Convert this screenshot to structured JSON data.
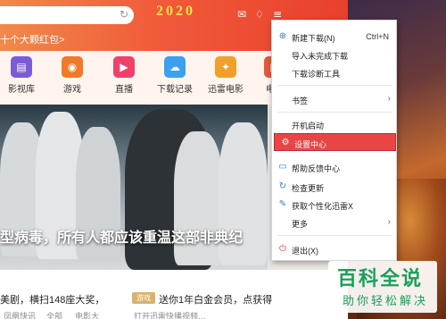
{
  "titlebar": {
    "promo_text": "十个大颗红包>",
    "logo_text": "2020",
    "icons": [
      "mail-icon",
      "shirt-icon",
      "menu-icon",
      "minimize-icon",
      "maximize-icon",
      "close-icon"
    ]
  },
  "nav": {
    "items": [
      {
        "label": "影视库",
        "icon": "film-library-icon",
        "color": "#7b5cd6"
      },
      {
        "label": "游戏",
        "icon": "gamepad-icon",
        "color": "#f07a2a"
      },
      {
        "label": "直播",
        "icon": "live-tv-icon",
        "color": "#f0416a"
      },
      {
        "label": "下载记录",
        "icon": "cloud-download-icon",
        "color": "#3aa0f0"
      },
      {
        "label": "迅雷电影",
        "icon": "thunder-movie-icon",
        "color": "#f0a02a"
      },
      {
        "label": "电影",
        "icon": "movie-icon",
        "color": "#e05a3a"
      }
    ]
  },
  "hero": {
    "caption": "型病毒，所有人都应该重温这部非典纪"
  },
  "bottom": {
    "line1_left": "美剧，横扫148座大奖，",
    "badge": "游戏",
    "line1_right": "送你1年白金会员，点获得",
    "line2_a": "凤凰快讯",
    "line2_b": "全部",
    "line2_c": "电影大",
    "line2_d": "打开迅雷快播视频..."
  },
  "menu": {
    "items": [
      {
        "label": "新建下载(N)",
        "shortcut": "Ctrl+N",
        "icon": "new-download-icon"
      },
      {
        "label": "导入未完成下载",
        "icon": ""
      },
      {
        "label": "下载诊断工具",
        "icon": ""
      },
      {
        "label": "书签",
        "icon": "",
        "submenu": true
      },
      {
        "label": "开机启动",
        "icon": ""
      },
      {
        "label": "设置中心",
        "icon": "settings-icon",
        "highlighted": true
      },
      {
        "label": "帮助反馈中心",
        "icon": "help-feedback-icon"
      },
      {
        "label": "检查更新",
        "icon": "check-update-icon"
      },
      {
        "label": "获取个性化迅雷X",
        "icon": "personalize-icon"
      },
      {
        "label": "更多",
        "icon": "",
        "submenu": true
      },
      {
        "label": "退出(X)",
        "icon": "power-icon"
      }
    ]
  },
  "watermark": {
    "title": "百科全说",
    "subtitle": "助你轻松解决"
  }
}
